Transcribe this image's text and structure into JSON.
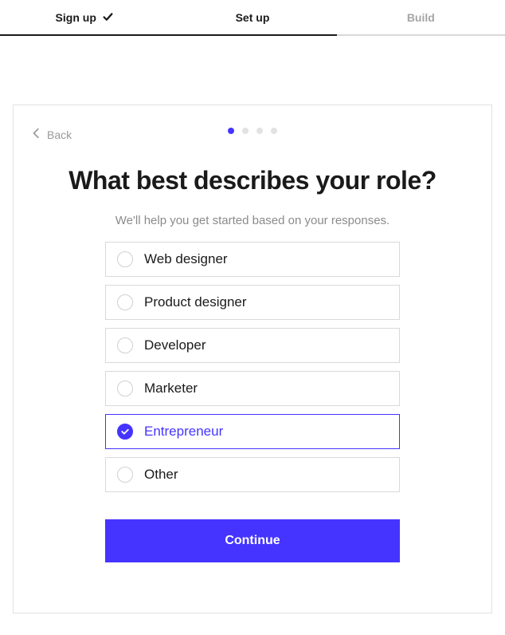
{
  "stepper": {
    "steps": [
      {
        "label": "Sign up",
        "completed": true,
        "active": true
      },
      {
        "label": "Set up",
        "completed": false,
        "active": true
      },
      {
        "label": "Build",
        "completed": false,
        "active": false
      }
    ]
  },
  "back": {
    "label": "Back"
  },
  "progress": {
    "total": 4,
    "current": 0
  },
  "heading": "What best describes your role?",
  "subheading": "We'll help you get started based on your responses.",
  "options": [
    {
      "label": "Web designer",
      "selected": false
    },
    {
      "label": "Product designer",
      "selected": false
    },
    {
      "label": "Developer",
      "selected": false
    },
    {
      "label": "Marketer",
      "selected": false
    },
    {
      "label": "Entrepreneur",
      "selected": true
    },
    {
      "label": "Other",
      "selected": false
    }
  ],
  "continue": {
    "label": "Continue"
  },
  "colors": {
    "accent": "#4534ff"
  }
}
